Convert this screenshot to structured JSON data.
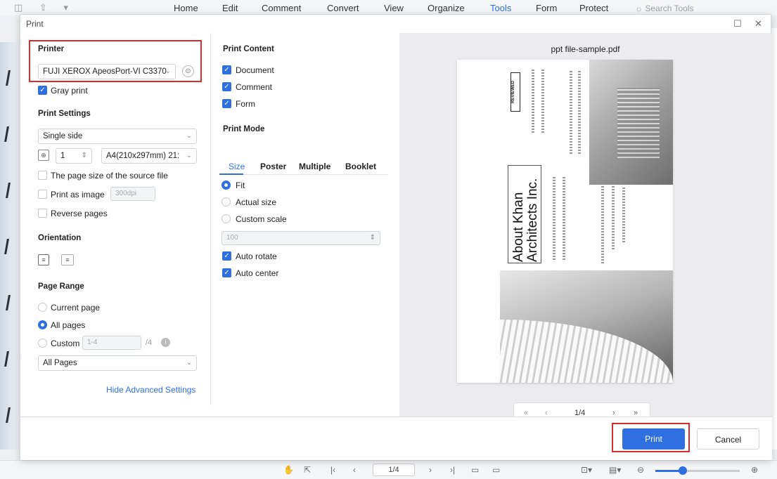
{
  "app_menu": {
    "items": [
      "Home",
      "Edit",
      "Comment",
      "Convert",
      "View",
      "Organize",
      "Tools",
      "Form",
      "Protect"
    ],
    "active": "Tools",
    "search_placeholder": "Search Tools"
  },
  "dialog": {
    "title": "Print",
    "printer": {
      "heading": "Printer",
      "selected": "FUJI XEROX ApeosPort-VI C3370",
      "gray_print_label": "Gray print",
      "gray_print_checked": true
    },
    "print_settings": {
      "heading": "Print Settings",
      "sides": "Single side",
      "copies": "1",
      "paper_size": "A4(210x297mm) 21:",
      "source_page_size_label": "The page size of the source file",
      "print_as_image_label": "Print as image",
      "dpi": "300dpi",
      "reverse_pages_label": "Reverse pages"
    },
    "orientation": {
      "heading": "Orientation"
    },
    "page_range": {
      "heading": "Page Range",
      "current_page_label": "Current page",
      "all_pages_label": "All pages",
      "custom_label": "Custom",
      "custom_placeholder": "1-4",
      "custom_total": "/4",
      "subset": "All Pages"
    },
    "hide_advanced": "Hide Advanced Settings",
    "print_content": {
      "heading": "Print Content",
      "items": [
        {
          "label": "Document",
          "checked": true
        },
        {
          "label": "Comment",
          "checked": true
        },
        {
          "label": "Form",
          "checked": true
        }
      ]
    },
    "print_mode": {
      "heading": "Print Mode",
      "tabs": [
        "Size",
        "Poster",
        "Multiple",
        "Booklet"
      ],
      "active_tab": "Size",
      "fit_label": "Fit",
      "actual_size_label": "Actual size",
      "custom_scale_label": "Custom scale",
      "scale_value": "100",
      "auto_rotate_label": "Auto rotate",
      "auto_center_label": "Auto center"
    },
    "preview": {
      "file_name": "ppt file-sample.pdf",
      "page_title_line1": "About Khan",
      "page_title_line2": "Architects Inc.",
      "stamp_text": "REVIEWED",
      "page_indicator": "1/4"
    },
    "buttons": {
      "print": "Print",
      "cancel": "Cancel"
    }
  },
  "status_bar": {
    "page": "1/4"
  },
  "colors": {
    "accent": "#2f6fe0",
    "highlight_box": "#d62c2c"
  }
}
